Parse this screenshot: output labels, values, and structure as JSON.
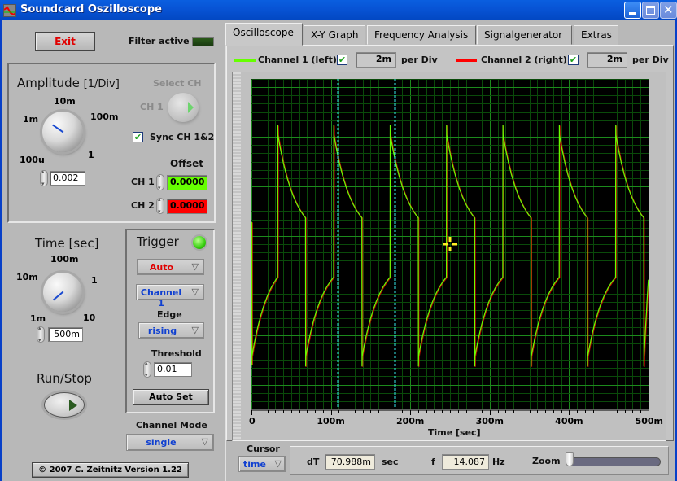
{
  "window": {
    "title": "Soundcard Oszilloscope",
    "controls": [
      "minimize",
      "maximize",
      "close"
    ]
  },
  "left_panel": {
    "exit_label": "Exit",
    "filter_label": "Filter active",
    "filter_active": false,
    "amplitude": {
      "title": "Amplitude",
      "unit": "[1/Div]",
      "ticks": [
        "100u",
        "1m",
        "10m",
        "100m",
        "1"
      ],
      "value": "0.002"
    },
    "select_ch": {
      "label": "Select CH",
      "current": "CH 1"
    },
    "sync": {
      "label": "Sync CH 1&2",
      "checked": true
    },
    "offset": {
      "title": "Offset",
      "ch1_label": "CH 1",
      "ch1_value": "0.0000",
      "ch2_label": "CH 2",
      "ch2_value": "0.0000"
    },
    "time": {
      "title": "Time [sec]",
      "ticks": [
        "1m",
        "10m",
        "100m",
        "1",
        "10"
      ],
      "value": "500m"
    },
    "run_stop_label": "Run/Stop",
    "trigger": {
      "title": "Trigger",
      "mode": "Auto",
      "channel": "Channel 1",
      "edge_label": "Edge",
      "edge": "rising",
      "threshold_label": "Threshold",
      "threshold": "0.01",
      "auto_set_label": "Auto Set"
    },
    "channel_mode": {
      "label": "Channel Mode",
      "value": "single"
    },
    "copyright": "© 2007   C. Zeitnitz Version 1.22"
  },
  "tabs": [
    {
      "label": "Oscilloscope",
      "active": true
    },
    {
      "label": "X-Y Graph",
      "active": false
    },
    {
      "label": "Frequency Analysis",
      "active": false
    },
    {
      "label": "Signalgenerator",
      "active": false
    },
    {
      "label": "Extras",
      "active": false
    }
  ],
  "channels": {
    "ch1": {
      "label": "Channel 1 (left)",
      "checked": true,
      "per_div": "2m",
      "per_div_label": "per Div",
      "color": "#66ff00"
    },
    "ch2": {
      "label": "Channel 2 (right)",
      "checked": true,
      "per_div": "2m",
      "per_div_label": "per Div",
      "color": "#ff0000"
    }
  },
  "cursor_panel": {
    "cursor_label": "Cursor",
    "cursor_mode": "time",
    "dt_label": "dT",
    "dt_value": "70.988m",
    "dt_unit": "sec",
    "f_label": "f",
    "f_value": "14.087",
    "f_unit": "Hz",
    "zoom_label": "Zoom",
    "zoom_level": 0
  },
  "chart_data": {
    "type": "line",
    "title": "",
    "xlabel": "Time [sec]",
    "ylabel": "",
    "xlim": [
      0,
      0.5
    ],
    "ylim": [
      -10,
      10
    ],
    "x_tick_labels": [
      "0",
      "100m",
      "200m",
      "300m",
      "400m",
      "500m"
    ],
    "x_ticks": [
      0,
      0.1,
      0.2,
      0.3,
      0.4,
      0.5
    ],
    "grid": true,
    "cursors_x": [
      0.109,
      0.18
    ],
    "marker": {
      "x": 0.25,
      "y": 0.0
    },
    "series": [
      {
        "name": "Channel 1 (left)",
        "color": "#66ff00",
        "period": 0.0708,
        "phase_start": 0.0,
        "rising_edge_times": [
          0.033,
          0.1035,
          0.1745,
          0.2455,
          0.3165,
          0.3875,
          0.4585
        ],
        "falling_edge_times": [
          0.068,
          0.139,
          0.21,
          0.281,
          0.352,
          0.423,
          0.494
        ],
        "levels": {
          "pre_rise": -2.0,
          "peak": 6.6,
          "pre_fall": 1.6,
          "trough": -6.8
        }
      },
      {
        "name": "Channel 2 (right)",
        "color": "#ff0000",
        "note": "overlaps Channel 1"
      }
    ]
  }
}
